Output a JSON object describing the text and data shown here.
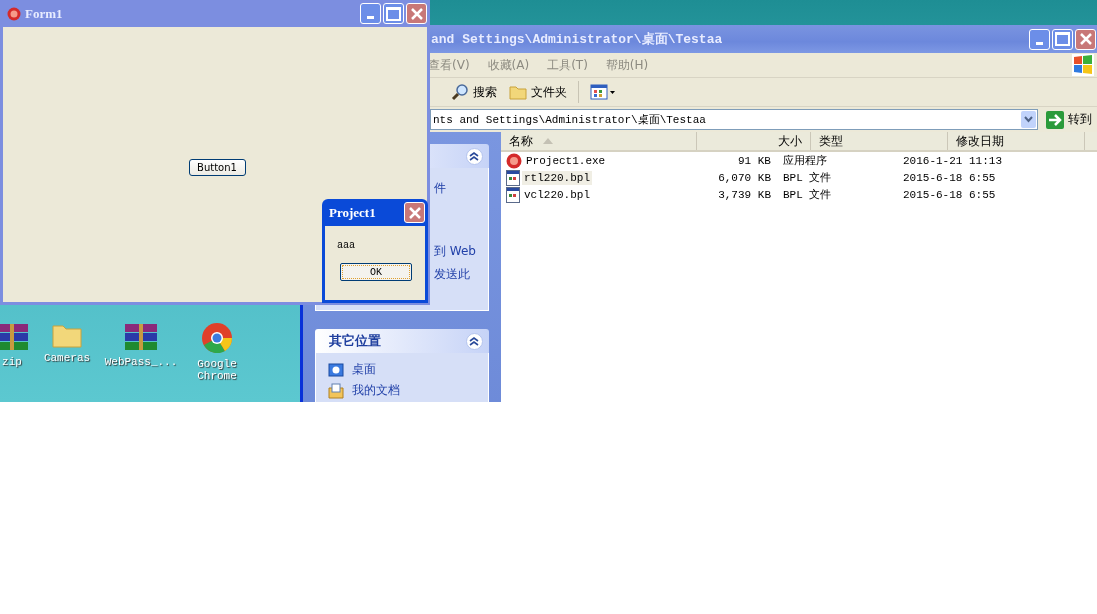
{
  "desktop": {
    "icons": [
      {
        "label": "zip",
        "kind": "archive"
      },
      {
        "label": "Cameras",
        "kind": "folder"
      },
      {
        "label": "WebPass_...",
        "kind": "archive"
      },
      {
        "label": "Google Chrome",
        "kind": "browser"
      }
    ]
  },
  "explorer": {
    "title": "and Settings\\Administrator\\桌面\\Testaa",
    "menu": [
      "查看(V)",
      "收藏(A)",
      "工具(T)",
      "帮助(H)"
    ],
    "toolbar": [
      {
        "label": "搜索",
        "kind": "search"
      },
      {
        "label": "文件夹",
        "kind": "folder"
      }
    ],
    "address": "nts and Settings\\Administrator\\桌面\\Testaa",
    "go": "转到",
    "task_panel": {
      "items": [
        "件",
        "到 Web",
        "发送此"
      ]
    },
    "places_panel": {
      "title": "其它位置",
      "items": [
        {
          "label": "桌面",
          "kind": "desktop"
        },
        {
          "label": "我的文档",
          "kind": "documents"
        }
      ]
    },
    "columns": [
      "名称",
      "大小",
      "类型",
      "修改日期"
    ],
    "rows": [
      {
        "name": "Project1.exe",
        "size": "91 KB",
        "type": "应用程序",
        "date": "2016-1-21 11:13",
        "kind": "app",
        "selected": false
      },
      {
        "name": "rtl220.bpl",
        "size": "6,070 KB",
        "type": "BPL 文件",
        "date": "2015-6-18 6:55",
        "kind": "library",
        "selected": true
      },
      {
        "name": "vcl220.bpl",
        "size": "3,739 KB",
        "type": "BPL 文件",
        "date": "2015-6-18 6:55",
        "kind": "library",
        "selected": false
      }
    ]
  },
  "form": {
    "title": "Form1",
    "button": "Button1"
  },
  "dialog": {
    "title": "Project1",
    "message": "aaa",
    "button": "OK"
  }
}
